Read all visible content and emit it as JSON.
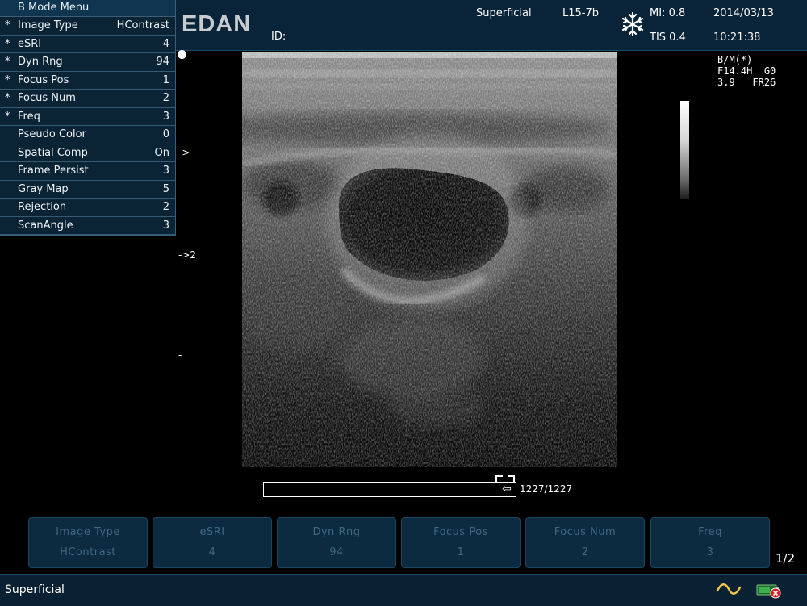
{
  "header": {
    "brand": "EDAN",
    "id_label": "ID:",
    "exam_preset": "Superficial",
    "probe": "L15-7b",
    "mi": "MI: 0.8",
    "tis": "TIS 0.4",
    "date": "2014/03/13",
    "time": "10:21:38"
  },
  "menu": {
    "title": "B Mode Menu",
    "items": [
      {
        "star": "*",
        "label": "Image Type",
        "value": "HContrast"
      },
      {
        "star": "*",
        "label": "eSRI",
        "value": "4"
      },
      {
        "star": "*",
        "label": "Dyn Rng",
        "value": "94"
      },
      {
        "star": "*",
        "label": "Focus Pos",
        "value": "1"
      },
      {
        "star": "*",
        "label": "Focus Num",
        "value": "2"
      },
      {
        "star": "*",
        "label": "Freq",
        "value": "3"
      },
      {
        "star": "",
        "label": "Pseudo Color",
        "value": "0"
      },
      {
        "star": "",
        "label": "Spatial Comp",
        "value": "On"
      },
      {
        "star": "",
        "label": "Frame Persist",
        "value": "3"
      },
      {
        "star": "",
        "label": "Gray Map",
        "value": "5"
      },
      {
        "star": "",
        "label": "Rejection",
        "value": "2"
      },
      {
        "star": "",
        "label": "ScanAngle",
        "value": "3"
      }
    ]
  },
  "markers": {
    "focus1": "->",
    "focus2": "->2",
    "tick": "-"
  },
  "params": {
    "mode": "B/M(*)",
    "freq": "F14.4H",
    "gain": "G0",
    "depth": "3.9",
    "frame_rate": "FR26"
  },
  "cine": {
    "counter": "1227/1227",
    "progress": 1.0
  },
  "softkeys": [
    {
      "label": "Image Type",
      "value": "HContrast"
    },
    {
      "label": "eSRI",
      "value": "4"
    },
    {
      "label": "Dyn Rng",
      "value": "94"
    },
    {
      "label": "Focus Pos",
      "value": "1"
    },
    {
      "label": "Focus Num",
      "value": "2"
    },
    {
      "label": "Freq",
      "value": "3"
    }
  ],
  "page_indicator": "1/2",
  "status": {
    "preset": "Superficial"
  },
  "icons": {
    "freeze": "snowflake-icon",
    "power": "ac-power-icon",
    "battery": "battery-error-icon"
  },
  "colors": {
    "panel": "#092338",
    "softkey_text": "#3f6881"
  }
}
